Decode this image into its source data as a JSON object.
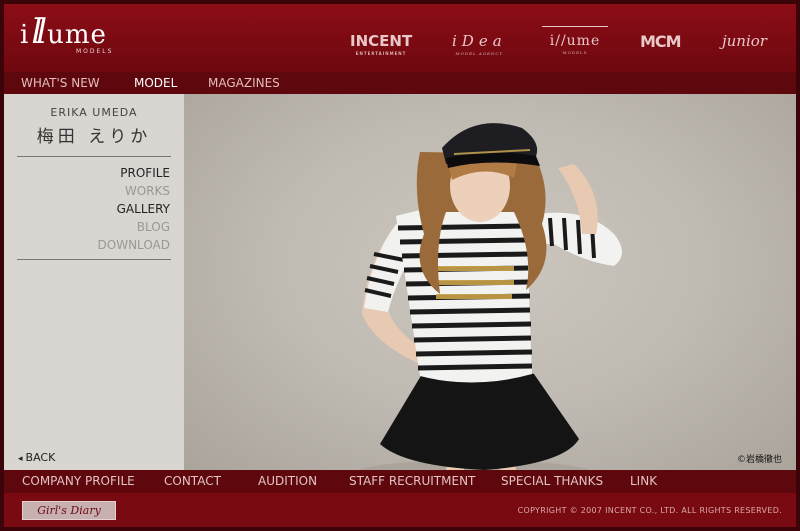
{
  "logo": {
    "text_left": "i",
    "text_slash": "ll",
    "text_right": "ume",
    "sub": "MODELS"
  },
  "brands": [
    {
      "name": "INCENT",
      "sub": "ENTERTAINMENT"
    },
    {
      "name": "iDea",
      "sub": "MODEL AGENCY"
    },
    {
      "name": "i//ume",
      "sub": "MODELS"
    },
    {
      "name": "MCM",
      "sub": ""
    },
    {
      "name": "junior",
      "sub": ""
    }
  ],
  "topnav": [
    "WHAT'S NEW",
    "MODEL",
    "MAGAZINES"
  ],
  "model": {
    "name_roman": "ERIKA UMEDA",
    "name_jp": "梅田 えりか"
  },
  "sidemenu": [
    "PROFILE",
    "WORKS",
    "GALLERY",
    "BLOG",
    "DOWNLOAD"
  ],
  "back_label": "BACK",
  "photo_credit": "©岩橋徹也",
  "bottomnav": [
    "COMPANY PROFILE",
    "CONTACT",
    "AUDITION",
    "STAFF RECRUITMENT",
    "SPECIAL THANKS",
    "LINK"
  ],
  "footer": {
    "banner": "Girl's Diary",
    "copyright": "COPYRIGHT © 2007 INCENT CO., LTD. ALL RIGHTS RESERVED."
  },
  "colors": {
    "header": "#7a0a12",
    "nav": "#5e070d",
    "sidebar": "#d9d6d2",
    "photo_bg": "#c3beb6"
  }
}
